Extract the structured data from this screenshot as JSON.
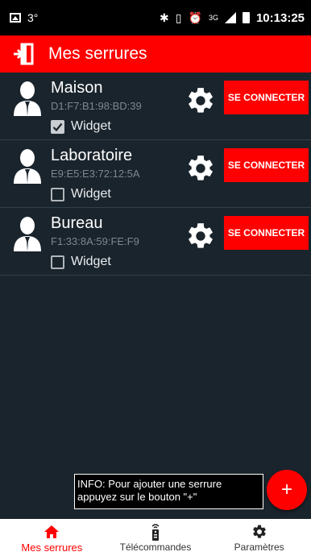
{
  "status_bar": {
    "temperature": "3°",
    "network": "3G",
    "time": "10:13:25"
  },
  "app_bar": {
    "title": "Mes serrures"
  },
  "locks": [
    {
      "name": "Maison",
      "mac": "D1:F7:B1:98:BD:39",
      "widget_label": "Widget",
      "widget_checked": true,
      "connect_label": "SE CONNECTER"
    },
    {
      "name": "Laboratoire",
      "mac": "E9:E5:E3:72:12:5A",
      "widget_label": "Widget",
      "widget_checked": false,
      "connect_label": "SE CONNECTER"
    },
    {
      "name": "Bureau",
      "mac": "F1:33:8A:59:FE:F9",
      "widget_label": "Widget",
      "widget_checked": false,
      "connect_label": "SE CONNECTER"
    }
  ],
  "info": {
    "line1": "INFO: Pour ajouter une serrure",
    "line2": "appuyez sur le bouton \"+\""
  },
  "fab": {
    "label": "+"
  },
  "bottom_nav": [
    {
      "label": "Mes serrures",
      "icon": "home-icon",
      "active": true
    },
    {
      "label": "Télécommandes",
      "icon": "remote-icon",
      "active": false
    },
    {
      "label": "Paramètres",
      "icon": "gear-icon",
      "active": false
    }
  ],
  "colors": {
    "accent": "#ff0000",
    "background": "#1a242c",
    "mac_text": "#7b8890"
  }
}
